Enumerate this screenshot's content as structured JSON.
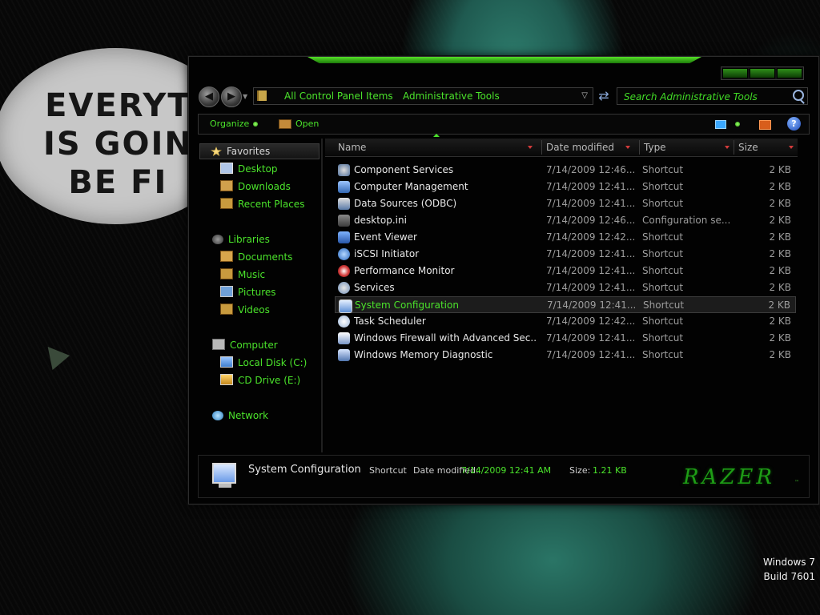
{
  "desktop": {
    "speech_lines": [
      "EVERYT",
      "IS GOIN",
      "BE FI"
    ],
    "watermark_line1": "Windows 7",
    "watermark_line2": "Build 7601"
  },
  "address_bar": {
    "crumbs": [
      "All Control Panel Items",
      "Administrative Tools"
    ],
    "search_placeholder": "Search Administrative Tools"
  },
  "command_bar": {
    "organize_label": "Organize",
    "open_label": "Open",
    "help_label": "?"
  },
  "navigation": {
    "favorites": {
      "label": "Favorites",
      "items": [
        "Desktop",
        "Downloads",
        "Recent Places"
      ]
    },
    "libraries": {
      "label": "Libraries",
      "items": [
        "Documents",
        "Music",
        "Pictures",
        "Videos"
      ]
    },
    "computer": {
      "label": "Computer",
      "items": [
        "Local Disk (C:)",
        "CD Drive (E:)"
      ]
    },
    "network": {
      "label": "Network"
    }
  },
  "file_list": {
    "columns": [
      "Name",
      "Date modified",
      "Type",
      "Size"
    ],
    "rows": [
      {
        "name": "Component Services",
        "date": "7/14/2009 12:46...",
        "type": "Shortcut",
        "size": "2 KB"
      },
      {
        "name": "Computer Management",
        "date": "7/14/2009 12:41...",
        "type": "Shortcut",
        "size": "2 KB"
      },
      {
        "name": "Data Sources (ODBC)",
        "date": "7/14/2009 12:41...",
        "type": "Shortcut",
        "size": "2 KB"
      },
      {
        "name": "desktop.ini",
        "date": "7/14/2009 12:46...",
        "type": "Configuration se...",
        "size": "2 KB"
      },
      {
        "name": "Event Viewer",
        "date": "7/14/2009 12:42...",
        "type": "Shortcut",
        "size": "2 KB"
      },
      {
        "name": "iSCSI Initiator",
        "date": "7/14/2009 12:41...",
        "type": "Shortcut",
        "size": "2 KB"
      },
      {
        "name": "Performance Monitor",
        "date": "7/14/2009 12:41...",
        "type": "Shortcut",
        "size": "2 KB"
      },
      {
        "name": "Services",
        "date": "7/14/2009 12:41...",
        "type": "Shortcut",
        "size": "2 KB"
      },
      {
        "name": "System Configuration",
        "date": "7/14/2009 12:41...",
        "type": "Shortcut",
        "size": "2 KB"
      },
      {
        "name": "Task Scheduler",
        "date": "7/14/2009 12:42...",
        "type": "Shortcut",
        "size": "2 KB"
      },
      {
        "name": "Windows Firewall with Advanced Sec...",
        "date": "7/14/2009 12:41...",
        "type": "Shortcut",
        "size": "2 KB"
      },
      {
        "name": "Windows Memory Diagnostic",
        "date": "7/14/2009 12:41...",
        "type": "Shortcut",
        "size": "2 KB"
      }
    ],
    "selected_index": 8
  },
  "details_pane": {
    "name": "System Configuration",
    "type": "Shortcut",
    "date_label": "Date modified:",
    "date_value": "7/14/2009 12:41 AM",
    "size_label": "Size:",
    "size_value": "1.21 KB",
    "brand_logo_text": "RAZER"
  },
  "colors": {
    "accent_green": "#4be32b",
    "window_bg": "#020202",
    "text_light": "#e7e7e7"
  },
  "icons": {
    "row_icons": [
      "gear-icon",
      "computer-management-icon",
      "database-icon",
      "ini-file-icon",
      "event-viewer-icon",
      "iscsi-icon",
      "performance-icon",
      "services-gear-icon",
      "system-config-icon",
      "clock-icon",
      "firewall-icon",
      "memory-diagnostic-icon"
    ]
  }
}
